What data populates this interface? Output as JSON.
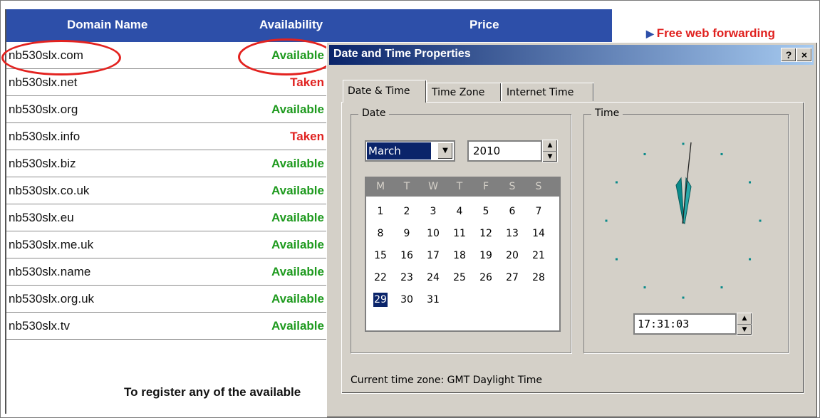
{
  "table": {
    "headers": {
      "domain": "Domain Name",
      "availability": "Availability",
      "price": "Price"
    },
    "rows": [
      {
        "domain": "nb530slx.com",
        "status": "Available"
      },
      {
        "domain": "nb530slx.net",
        "status": "Taken"
      },
      {
        "domain": "nb530slx.org",
        "status": "Available"
      },
      {
        "domain": "nb530slx.info",
        "status": "Taken"
      },
      {
        "domain": "nb530slx.biz",
        "status": "Available"
      },
      {
        "domain": "nb530slx.co.uk",
        "status": "Available"
      },
      {
        "domain": "nb530slx.eu",
        "status": "Available"
      },
      {
        "domain": "nb530slx.me.uk",
        "status": "Available"
      },
      {
        "domain": "nb530slx.name",
        "status": "Available"
      },
      {
        "domain": "nb530slx.org.uk",
        "status": "Available"
      },
      {
        "domain": "nb530slx.tv",
        "status": "Available"
      }
    ],
    "register_text": "To register any of the available"
  },
  "sidebar": {
    "forwarding_link": "Free web forwarding"
  },
  "colors": {
    "header_blue": "#2d4fa9",
    "available_green": "#1e9a1e",
    "taken_red": "#e0211f",
    "annotation_red": "#e3221f"
  },
  "dialog": {
    "title": "Date and Time Properties",
    "help_button": "?",
    "close_button": "×",
    "tabs": [
      "Date & Time",
      "Time Zone",
      "Internet Time"
    ],
    "date_group_label": "Date",
    "time_group_label": "Time",
    "month": "March",
    "year": "2010",
    "weekdays": [
      "M",
      "T",
      "W",
      "T",
      "F",
      "S",
      "S"
    ],
    "weeks": [
      [
        "1",
        "2",
        "3",
        "4",
        "5",
        "6",
        "7"
      ],
      [
        "8",
        "9",
        "10",
        "11",
        "12",
        "13",
        "14"
      ],
      [
        "15",
        "16",
        "17",
        "18",
        "19",
        "20",
        "21"
      ],
      [
        "22",
        "23",
        "24",
        "25",
        "26",
        "27",
        "28"
      ],
      [
        "29",
        "30",
        "31",
        "",
        "",
        "",
        ""
      ]
    ],
    "selected_day": "29",
    "time": "17:31:03",
    "time_zone_text": "Current time zone:  GMT Daylight Time"
  }
}
